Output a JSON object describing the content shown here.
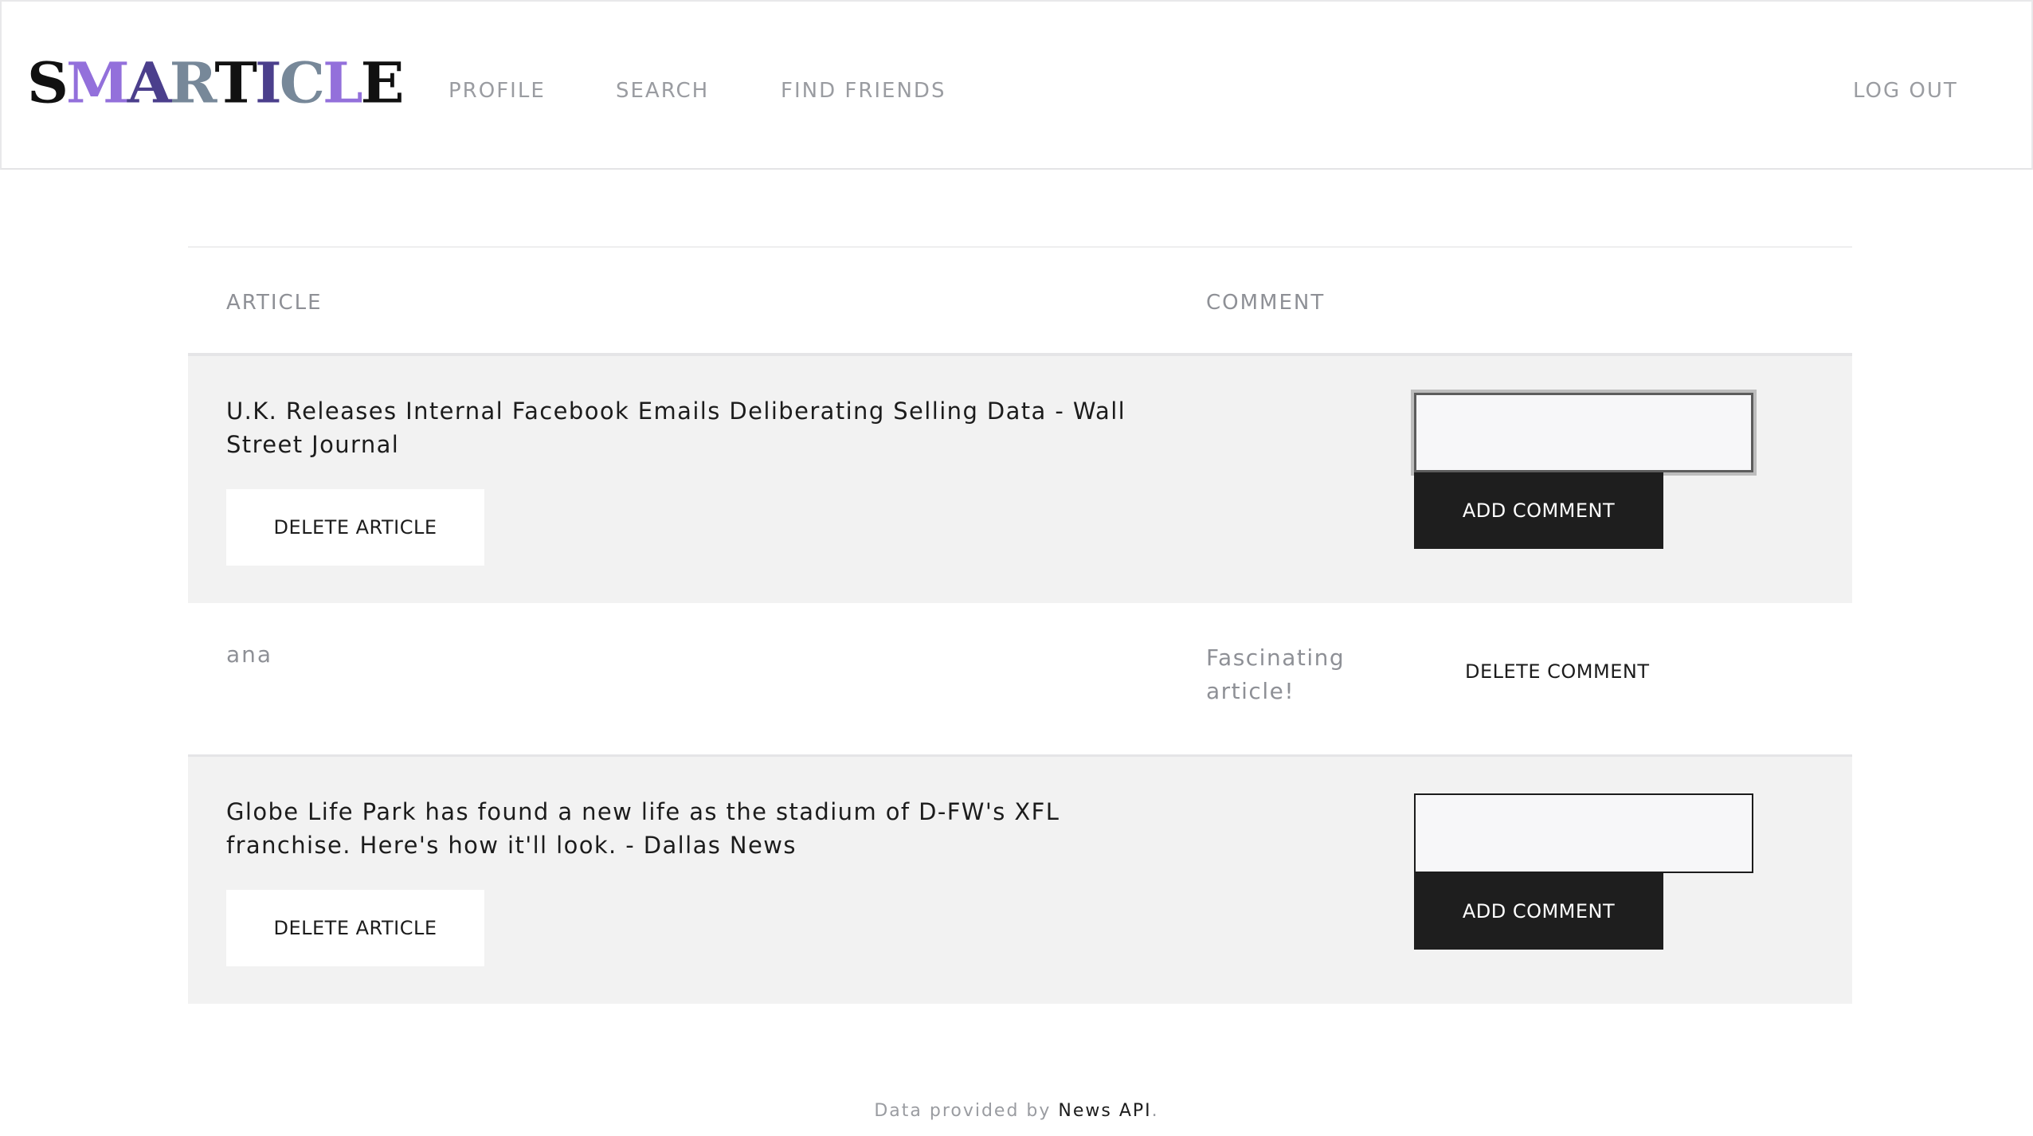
{
  "header": {
    "logo": {
      "letters": [
        {
          "char": "S",
          "color": "#111111"
        },
        {
          "char": "M",
          "color": "#9370db"
        },
        {
          "char": "A",
          "color": "#4b3f8c"
        },
        {
          "char": "R",
          "color": "#778899"
        },
        {
          "char": "T",
          "color": "#111111"
        },
        {
          "char": "I",
          "color": "#4b3f8c"
        },
        {
          "char": "C",
          "color": "#778899"
        },
        {
          "char": "L",
          "color": "#9370db"
        },
        {
          "char": "E",
          "color": "#111111"
        }
      ]
    },
    "nav": {
      "profile": "PROFILE",
      "search": "SEARCH",
      "find_friends": "FIND FRIENDS",
      "logout": "LOG OUT"
    }
  },
  "table": {
    "headers": {
      "article": "ARTICLE",
      "comment": "COMMENT"
    },
    "rows": [
      {
        "title": "U.K. Releases Internal Facebook Emails Deliberating Selling Data - Wall Street Journal",
        "delete_label": "DELETE ARTICLE",
        "input_value": "",
        "add_label": "ADD COMMENT",
        "comments": [
          {
            "user": "ana",
            "text": "Fascinating article!",
            "delete_label": "DELETE COMMENT"
          }
        ]
      },
      {
        "title": "Globe Life Park has found a new life as the stadium of D-FW's XFL franchise. Here's how it'll look. - Dallas News",
        "delete_label": "DELETE ARTICLE",
        "input_value": "",
        "add_label": "ADD COMMENT",
        "comments": []
      }
    ]
  },
  "footer": {
    "prefix": "Data provided by ",
    "link": "News API",
    "suffix": "."
  },
  "colors": {
    "accent_dark": "#1e1e1e",
    "row_bg": "#f2f2f2",
    "muted_text": "#8e9096"
  }
}
